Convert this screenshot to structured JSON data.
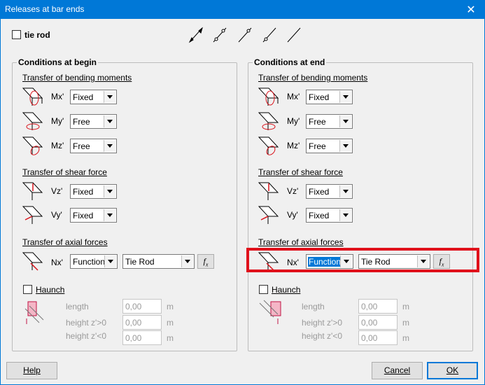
{
  "window": {
    "title": "Releases at bar ends",
    "close_glyph": "✕"
  },
  "tie_rod": {
    "label": "tie rod",
    "checked": false
  },
  "begin": {
    "title": "Conditions at begin",
    "bending_title": "Transfer of bending moments",
    "mx_label": "Mx'",
    "mx_value": "Fixed",
    "my_label": "My'",
    "my_value": "Free",
    "mz_label": "Mz'",
    "mz_value": "Free",
    "shear_title": "Transfer of shear force",
    "vz_label": "Vz'",
    "vz_value": "Fixed",
    "vy_label": "Vy'",
    "vy_value": "Fixed",
    "axial_title": "Transfer of axial forces",
    "nx_label": "Nx'",
    "nx_value": "Function",
    "nx_function": "Tie Rod",
    "haunch_label": "Haunch",
    "length_label": "length",
    "length_value": "0,00",
    "length_unit": "m",
    "hpos_label": "height z'>0",
    "hpos_value": "0,00",
    "hpos_unit": "m",
    "hneg_label": "height z'<0",
    "hneg_value": "0,00",
    "hneg_unit": "m"
  },
  "end": {
    "title": "Conditions at end",
    "bending_title": "Transfer of bending moments",
    "mx_label": "Mx'",
    "mx_value": "Fixed",
    "my_label": "My'",
    "my_value": "Free",
    "mz_label": "Mz'",
    "mz_value": "Free",
    "shear_title": "Transfer of shear force",
    "vz_label": "Vz'",
    "vz_value": "Fixed",
    "vy_label": "Vy'",
    "vy_value": "Fixed",
    "axial_title": "Transfer of axial forces",
    "nx_label": "Nx'",
    "nx_value": "Function",
    "nx_function": "Tie Rod",
    "haunch_label": "Haunch",
    "length_label": "length",
    "length_value": "0,00",
    "length_unit": "m",
    "hpos_label": "height z'>0",
    "hpos_value": "0,00",
    "hpos_unit": "m",
    "hneg_label": "height z'<0",
    "hneg_value": "0,00",
    "hneg_unit": "m"
  },
  "buttons": {
    "help": "Help",
    "cancel": "Cancel",
    "ok": "OK"
  },
  "colors": {
    "titlebar": "#0078d7",
    "highlight": "#e0111b",
    "icon_red": "#d9131b"
  }
}
